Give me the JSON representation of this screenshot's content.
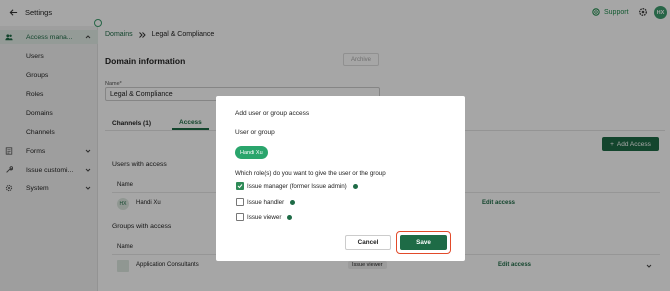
{
  "topbar": {
    "back_label": "Settings",
    "support_label": "Support",
    "avatar_initials": "HX"
  },
  "sidebar": {
    "access": "Access mana...",
    "sub_items": [
      "Users",
      "Groups",
      "Roles",
      "Domains",
      "Channels"
    ],
    "forms": "Forms",
    "issue": "Issue customi...",
    "system": "System"
  },
  "main": {
    "breadcrumb": {
      "parent": "Domains",
      "current": "Legal & Compliance"
    },
    "title": "Domain information",
    "archive_label": "Archive",
    "name_label": "Name*",
    "name_value": "Legal & Compliance",
    "tabs": [
      {
        "label": "Channels (1)"
      },
      {
        "label": "Access"
      }
    ],
    "add_access_label": "Add Access",
    "users_section": "Users with access",
    "groups_section": "Groups with access",
    "col_name": "Name",
    "user_row": {
      "initials": "HX",
      "name": "Handi Xu",
      "edit": "Edit access"
    },
    "group_row": {
      "name": "Application Consultants",
      "role": "Issue viewer",
      "edit": "Edit access"
    }
  },
  "modal": {
    "title": "Add user or group access",
    "user_or_group_label": "User or group",
    "selected_user": "Handi Xu",
    "question": "Which role(s) do you want to give the user or the group",
    "options": [
      {
        "label": "Issue manager (former Issue admin)",
        "checked": true
      },
      {
        "label": "Issue handler",
        "checked": false
      },
      {
        "label": "Issue viewer",
        "checked": false
      }
    ],
    "cancel_label": "Cancel",
    "save_label": "Save"
  },
  "colors": {
    "accent": "#1e6b46",
    "chip": "#2aa56c",
    "highlight": "#e24a2a"
  }
}
